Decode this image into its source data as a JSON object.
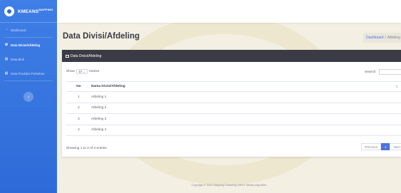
{
  "brand": {
    "name": "KMEANS",
    "sup": "MAPPING"
  },
  "sidebar": {
    "items": [
      {
        "label": "Dashboard",
        "icon": "dashboard-icon",
        "active": false
      },
      {
        "label": "Data Divisi/Afdeling",
        "icon": "gear-icon",
        "active": true
      },
      {
        "label": "Data Blok",
        "icon": "table-icon",
        "active": false
      },
      {
        "label": "Data Produksi Perkebun",
        "icon": "table-icon",
        "active": false
      }
    ],
    "toggle_glyph": "‹"
  },
  "page": {
    "title": "Data Divisi/Afdeling",
    "breadcrumb": {
      "home": "Dashboard",
      "separator": "/",
      "current": "Afdeling"
    }
  },
  "card": {
    "title": "Data Divisi/Afdeling",
    "show_prefix": "Show",
    "entries_value": "10",
    "show_suffix": "entries",
    "search_label": "Search:",
    "columns": {
      "no": "No",
      "name": "Nama Divisi/Afdeling"
    },
    "rows": [
      {
        "no": "1",
        "name": "Afdeling 1"
      },
      {
        "no": "2",
        "name": "Afdeling 2"
      },
      {
        "no": "3",
        "name": "Afdeling 3"
      },
      {
        "no": "4",
        "name": "Afdeling 4"
      }
    ],
    "info": "Showing 1 to 4 of 4 entries",
    "pagination": {
      "previous": "Previous",
      "page": "1",
      "next": "Next"
    }
  },
  "footer": "Copyright © 2023 Mapping Clustering With K-Means Algorithm",
  "colors": {
    "sidebar": "#3f7ee6",
    "header_bar": "#3a3b45",
    "accent": "#4e73df",
    "background": "#f3efe2"
  }
}
